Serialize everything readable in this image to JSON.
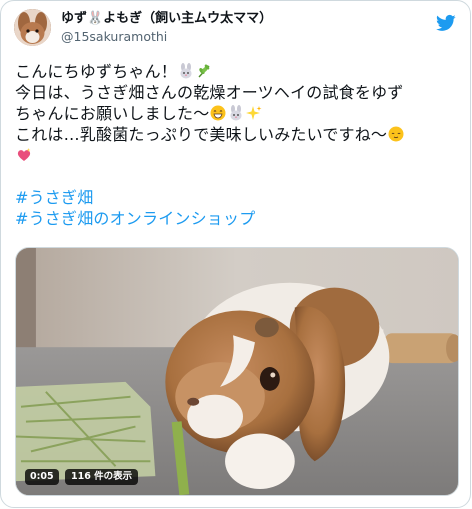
{
  "tweet": {
    "author_name": "ゆず🐰よもぎ（飼い主ムウ太ママ）",
    "author_handle": "@15sakuramothi",
    "lines": [
      "こんにちゆずちゃん！",
      "今日は、うさぎ畑さんの乾燥オーツヘイの試食をゆず",
      "ちゃんにお願いしました〜",
      "これは…乳酸菌たっぷりで美味しいみたいですね〜"
    ],
    "hashtags": [
      "#うさぎ畑",
      "#うさぎ畑のオンラインショップ"
    ]
  },
  "icons": {
    "avatar": "rabbit-avatar",
    "logo": "twitter-bird-icon",
    "emoji_line1": [
      "rabbit-emoji",
      "herb-emoji"
    ],
    "emoji_line3": [
      "grinning-emoji",
      "rabbit-emoji",
      "sparkles-emoji"
    ],
    "emoji_line4": [
      "relieved-emoji",
      "sparkling-heart-emoji"
    ]
  },
  "video": {
    "time": "0:05",
    "views": "116 件の表示"
  },
  "colors": {
    "accent": "#1d9bf0",
    "text": "#0f1419",
    "muted": "#536471"
  }
}
